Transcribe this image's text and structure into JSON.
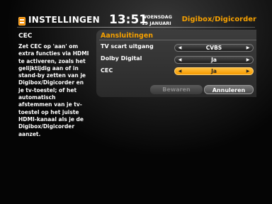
{
  "header": {
    "menu_icon": "menu-settings-icon",
    "title": "INSTELLINGEN",
    "time": "13:51",
    "weekday": "WOENSDAG",
    "date": "19 JANUARI",
    "device": "Digibox/Digicorder"
  },
  "help": {
    "title": "CEC",
    "text": "Zet CEC op 'aan' om extra functies via HDMI te activeren, zoals het gelijktijdig aan of in stand-by zetten van je Digibox/Digicorder en je tv-toestel; of het automatisch afstemmen van je tv-toestel op het juiste HDMI-kanaal als je de Digibox/Digicorder aanzet."
  },
  "panel": {
    "title": "Aansluitingen",
    "rows": [
      {
        "label": "TV scart uitgang",
        "value": "CVBS",
        "focused": false
      },
      {
        "label": "Dolby Digital",
        "value": "Ja",
        "focused": false
      },
      {
        "label": "CEC",
        "value": "Ja",
        "focused": true
      }
    ],
    "arrow_left": "◀",
    "arrow_right": "▶",
    "save_label": "Bewaren",
    "cancel_label": "Annuleren"
  },
  "colors": {
    "accent": "#f5a000",
    "focus": "#ffb020",
    "disabled_text": "#8a8a8a"
  }
}
